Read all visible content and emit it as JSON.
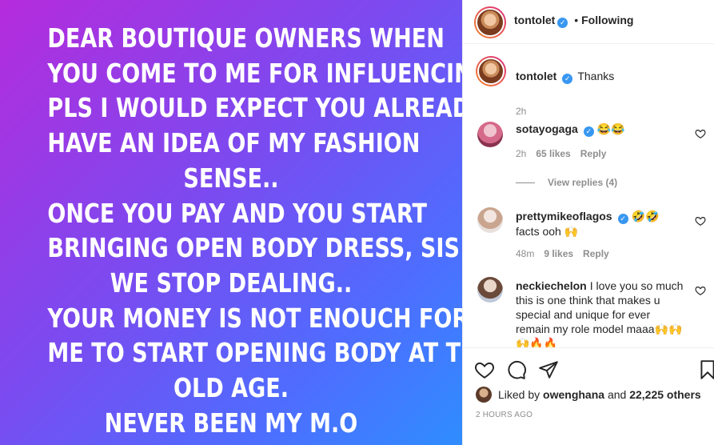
{
  "post": {
    "lines": [
      "DEAR BOUTIQUE OWNERS WHEN",
      "YOU COME TO ME FOR INFLUENCING,",
      "PLS I WOULD EXPECT YOU ALREADY",
      "HAVE AN IDEA OF MY FASHION",
      "SENSE..",
      "ONCE YOU PAY AND YOU START",
      "BRINGING OPEN BODY DRESS, SIS",
      "WE STOP DEALING..",
      "YOUR MONEY IS NOT ENOUCH FOR",
      "ME TO START OPENING BODY AT THIS",
      "OLD AGE.",
      "NEVER BEEN MY M.O"
    ],
    "gradient": [
      "#b52bdc",
      "#7a4bf0",
      "#4f6cff",
      "#2f8dff"
    ]
  },
  "header": {
    "username": "tontolet",
    "separator": "•",
    "follow_status": "Following"
  },
  "caption": {
    "username": "tontolet",
    "text": "Thanks",
    "time": "2h"
  },
  "comments": [
    {
      "username": "sotayogaga",
      "text": "😂😂",
      "time": "2h",
      "likes": "65 likes",
      "reply": "Reply",
      "verified": true
    },
    {
      "username": "prettymikeoflagos",
      "text": "🤣🤣 facts ooh 🙌",
      "time": "48m",
      "likes": "9 likes",
      "reply": "Reply",
      "verified": true
    },
    {
      "username": "neckiechelon",
      "text": "I love you so much this is one think that makes u special and unique for ever remain my role model maaa🙌🙌🙌🔥🔥",
      "verified": false
    }
  ],
  "view_replies": "View replies (4)",
  "footer": {
    "liked_by_prefix": "Liked by",
    "liked_by_user": "owenghana",
    "liked_by_and": "and",
    "liked_by_count": "22,225 others",
    "timestamp": "2 HOURS AGO"
  },
  "icons": {
    "like": "heart-icon",
    "comment": "comment-icon",
    "share": "share-icon",
    "save": "bookmark-icon",
    "verified": "verified-badge-icon",
    "comment_like": "heart-icon"
  },
  "colors": {
    "verified": "#3897f0",
    "meta_text": "#8e8e8e",
    "primary_text": "#262626"
  }
}
